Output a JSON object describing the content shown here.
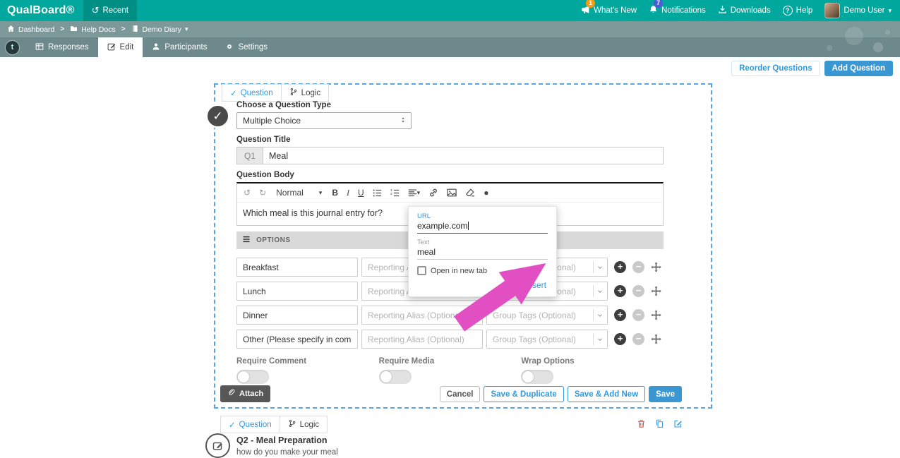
{
  "icons": {
    "recent": "↺",
    "caret_down": "▾",
    "breadcrumb_separator": ">",
    "check": "✓",
    "undo": "↺",
    "redo": "↻",
    "bold": "B",
    "italic": "I",
    "underline": "U",
    "special_dot": "●",
    "plus": "+",
    "minus": "−",
    "help": "?",
    "project_initial": "t"
  },
  "topbar": {
    "logo": "QualBoard®",
    "recent": "Recent",
    "whats_new": "What's New",
    "whats_new_badge": "1",
    "notifications": "Notifications",
    "notifications_badge": "7",
    "downloads": "Downloads",
    "help": "Help",
    "user": "Demo User"
  },
  "breadcrumb": {
    "dashboard": "Dashboard",
    "help_docs": "Help Docs",
    "demo_diary": "Demo Diary"
  },
  "tabs": {
    "responses": "Responses",
    "edit": "Edit",
    "participants": "Participants",
    "settings": "Settings"
  },
  "actions": {
    "reorder": "Reorder Questions",
    "add": "Add Question"
  },
  "editor": {
    "tab_question": "Question",
    "tab_logic": "Logic",
    "type_label": "Choose a Question Type",
    "type_value": "Multiple Choice",
    "title_label": "Question Title",
    "number": "Q1",
    "title_value": "Meal",
    "body_label": "Question Body",
    "format": "Normal",
    "body_text": "Which meal is this journal entry for?",
    "options_header": "OPTIONS",
    "options": [
      {
        "value": "Breakfast",
        "alias": "Reporting Alias (Optional)",
        "tags": "Group Tags (Optional)"
      },
      {
        "value": "Lunch",
        "alias": "Reporting Alias (Optional)",
        "tags": "Group Tags (Optional)"
      },
      {
        "value": "Dinner",
        "alias": "Reporting Alias (Optional)",
        "tags": "Group Tags (Optional)"
      },
      {
        "value": "Other (Please specify in comme",
        "alias": "Reporting Alias (Optional)",
        "tags": "Group Tags (Optional)"
      }
    ],
    "toggle_comment": "Require Comment",
    "toggle_media": "Require Media",
    "toggle_wrap": "Wrap Options",
    "attach": "Attach",
    "cancel": "Cancel",
    "save_duplicate": "Save & Duplicate",
    "save_add_new": "Save & Add New",
    "save": "Save"
  },
  "link_popup": {
    "url_label": "URL",
    "url_value": "example.com",
    "text_label": "Text",
    "text_value": "meal",
    "new_tab": "Open in new tab",
    "insert": "Insert"
  },
  "question2": {
    "tab_question": "Question",
    "tab_logic": "Logic",
    "title": "Q2 - Meal Preparation",
    "body": "how do you make your meal"
  },
  "colors": {
    "brand_teal": "#00a79d",
    "accent_blue": "#3498db",
    "arrow_pink": "#e14fc3",
    "badge_orange": "#f39c12",
    "badge_blue": "#4a5fd6"
  }
}
